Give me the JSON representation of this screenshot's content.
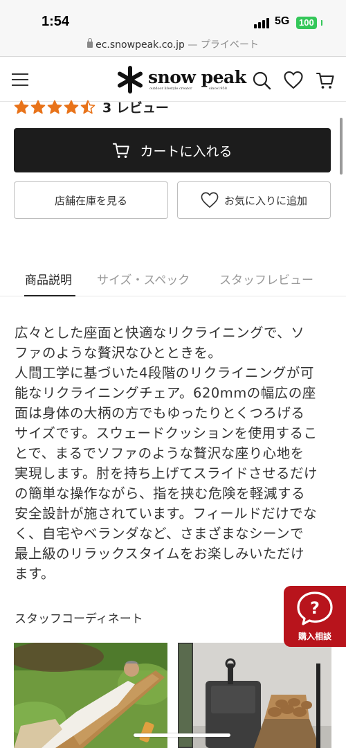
{
  "status_bar": {
    "time": "1:54",
    "network": "5G",
    "battery": "100"
  },
  "url_bar": {
    "domain": "ec.snowpeak.co.jp",
    "separator": " — ",
    "mode": "プライベート"
  },
  "header": {
    "logo_text": "snow peak",
    "logo_subtext": "outdoor lifestyle creator",
    "logo_since": "since1958",
    "icons": [
      "hamburger-menu-icon",
      "search-icon",
      "heart-icon",
      "cart-icon"
    ]
  },
  "reviews": {
    "rating": 4.5,
    "max_rating": 5,
    "count_label": "3 レビュー"
  },
  "actions": {
    "add_to_cart": "カートに入れる",
    "store_stock": "店舗在庫を見る",
    "add_favorite": "お気に入りに追加"
  },
  "tabs": [
    {
      "label": "商品説明",
      "active": true
    },
    {
      "label": "サイズ・スペック",
      "active": false
    },
    {
      "label": "スタッフレビュー",
      "active": false
    }
  ],
  "description": {
    "lines": [
      "広々とした座面と快適なリクライニングで、ソ",
      "ファのような贅沢なひとときを。",
      "人間工学に基づいた4段階のリクライニングが可",
      "能なリクライニングチェア。620mmの幅広の座",
      "面は身体の大柄の方でもゆったりとくつろげる",
      "サイズです。スウェードクッションを使用するこ",
      "とで、まるでソファのような贅沢な座り心地を",
      "実現します。肘を持ち上げてスライドさせるだけ",
      "の簡単な操作ながら、指を挟む危険を軽減する",
      "安全設計が施されています。フィールドだけでな",
      "く、自宅やベランダなど、さまざまなシーンで",
      "最上級のリラックスタイムをお楽しみいただけ",
      "ます。"
    ]
  },
  "staff_coordinate": {
    "title": "スタッフコーディネート"
  },
  "consult_badge": {
    "label": "購入相談"
  },
  "colors": {
    "accent_red": "#b8141c",
    "star_orange": "#e8731a",
    "button_dark": "#1c1c1c",
    "battery_green": "#34c759"
  }
}
